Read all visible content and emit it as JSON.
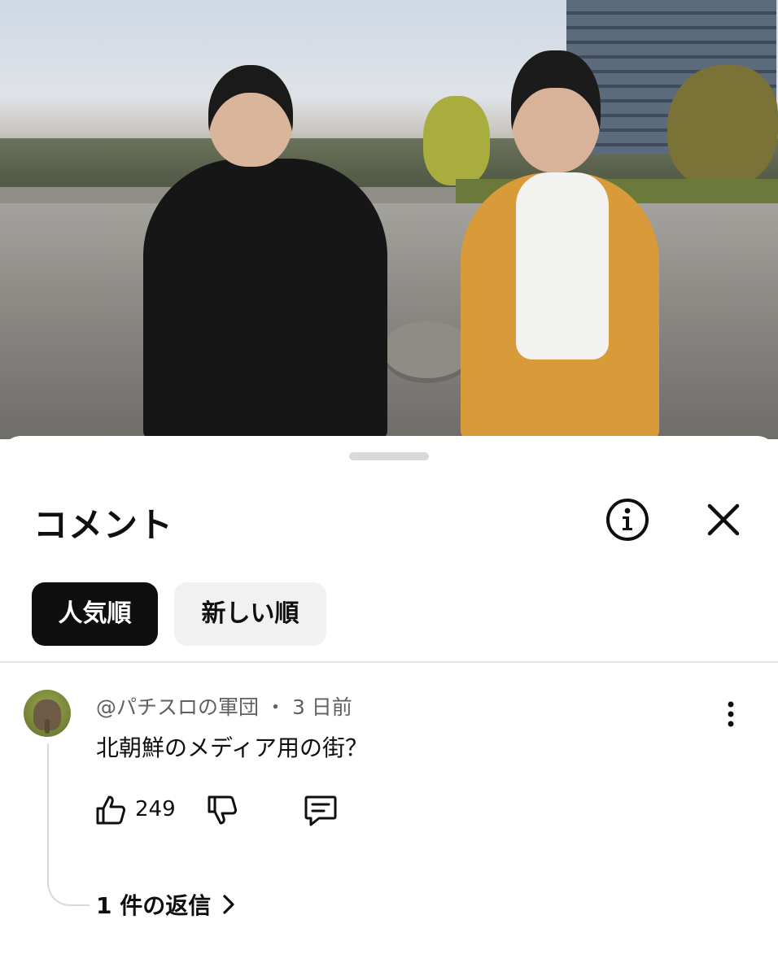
{
  "sheet": {
    "title": "コメント",
    "info_icon": "info-icon",
    "close_icon": "close-icon"
  },
  "sort_chips": [
    {
      "label": "人気順",
      "selected": true
    },
    {
      "label": "新しい順",
      "selected": false
    }
  ],
  "comment": {
    "author": "@パチスロの軍団",
    "separator": "・",
    "time": "3 日前",
    "text": "北朝鮮のメディア用の街？",
    "like_count": "249",
    "replies_label": "1 件の返信"
  },
  "colors": {
    "chip_active_bg": "#0f0f0f",
    "chip_inactive_bg": "#f1f1f1",
    "meta_text": "#606060"
  }
}
